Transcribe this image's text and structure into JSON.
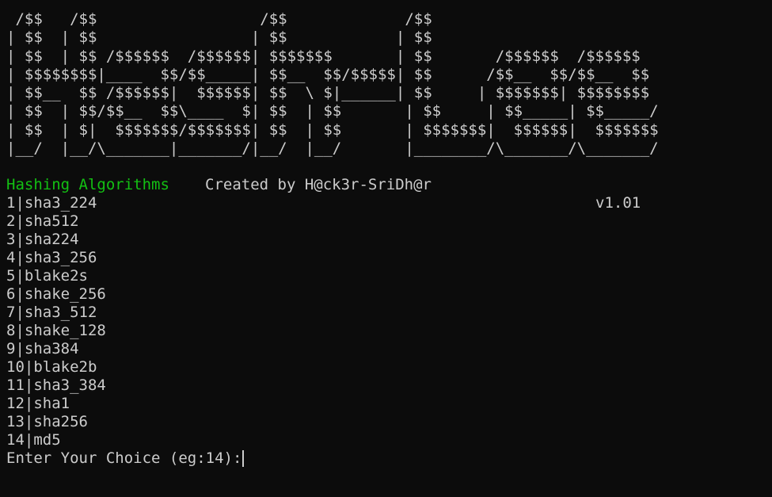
{
  "banner": {
    "ascii_art": " /$$   /$$                  /$$             /$$\n| $$  | $$                 | $$            | $$\n| $$  | $$ /$$$$$$  /$$$$$$| $$$$$$$       | $$       /$$$$$$  /$$$$$$\n| $$$$$$$$|____  $$/$$_____| $$__  $$/$$$$$| $$      /$$__  $$/$$__  $$\n| $$__  $$ /$$$$$$|  $$$$$$| $$  \\ $|______| $$     | $$$$$$$| $$$$$$$$\n| $$  | $$/$$__  $$\\____  $| $$  | $$       | $$     | $$_____| $$_____/\n| $$  | $|  $$$$$$$/$$$$$$$| $$  | $$       | $$$$$$$|  $$$$$$|  $$$$$$$\n|__/  |__/\\_______|_______/|__/  |__/       |________/\\_______/\\_______/",
    "credit": "Created by H@ck3r-SriDh@r",
    "version": "v1.01"
  },
  "menu": {
    "title": "Hashing Algorithms",
    "items": [
      "1|sha3_224",
      "2|sha512",
      "3|sha224",
      "4|sha3_256",
      "5|blake2s",
      "6|shake_256",
      "7|sha3_512",
      "8|shake_128",
      "9|sha384",
      "10|blake2b",
      "11|sha3_384",
      "12|sha1",
      "13|sha256",
      "14|md5"
    ]
  },
  "prompt": {
    "text": "Enter Your Choice (eg:14):",
    "value": ""
  },
  "colors": {
    "background": "#0c0c0c",
    "foreground": "#cccccc",
    "section_title": "#13c013"
  }
}
